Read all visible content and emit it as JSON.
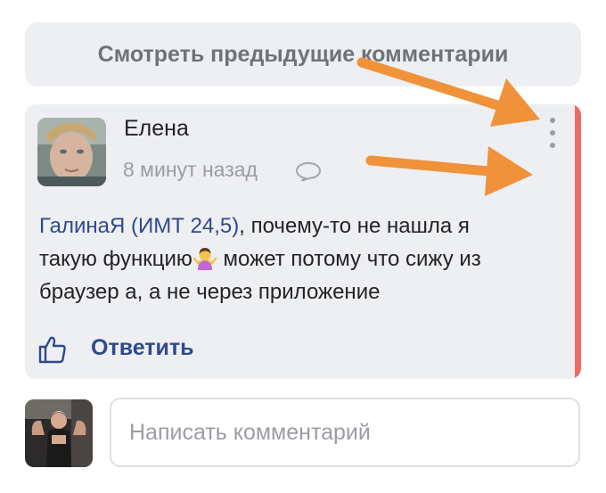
{
  "load_previous": {
    "label": "Смотреть предыдущие комментарии"
  },
  "comment": {
    "author": "Елена",
    "time": "8 минут назад",
    "mention": "ГалинаЯ (ИМТ 24,5)",
    "text_line1_rest": ", почему-то не нашла я",
    "text_line2_before_emoji": "такую функцию",
    "text_line2_after_emoji": " может потому что сижу из",
    "text_line3": "браузер а, а не через приложение",
    "reply_label": "Ответить"
  },
  "composer": {
    "placeholder": "Написать комментарий"
  },
  "colors": {
    "accent_bar": "#ee6a64",
    "link": "#2e4a8c",
    "annotation_arrow": "#f0923a",
    "card_bg": "#eeeff3"
  },
  "icons": [
    "kebab-menu-icon",
    "speech-bubble-icon",
    "thumbs-up-icon",
    "person-shrugging-emoji"
  ]
}
